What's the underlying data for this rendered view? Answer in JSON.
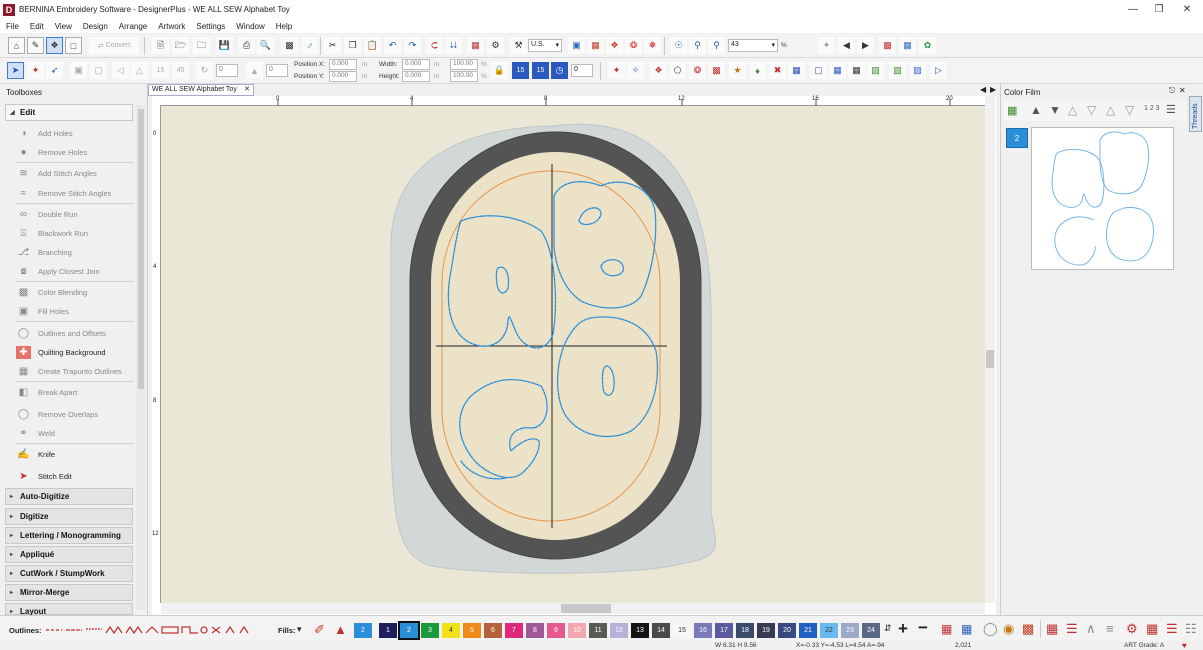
{
  "window": {
    "app_letter": "D",
    "title": "BERNINA Embroidery Software - DesignerPlus - WE ALL SEW Alphabet Toy"
  },
  "menu": [
    "File",
    "Edit",
    "View",
    "Design",
    "Arrange",
    "Artwork",
    "Settings",
    "Window",
    "Help"
  ],
  "toolbar1": {
    "convert_label": "Convert",
    "units_value": "U.S.",
    "zoom_value": "43",
    "zoom_unit": "%"
  },
  "toolbar2": {
    "rotate1": "15",
    "rotate2": "45",
    "angle_value": "0",
    "slant_value": "0",
    "position_x_label": "Position X:",
    "position_y_label": "Position Y:",
    "position_x_value": "0.000",
    "position_y_value": "0.000",
    "unit_in": "in",
    "width_label": "Width:",
    "height_label": "Height:",
    "width_value": "0.000",
    "height_value": "0.000",
    "width_pct": "100.00",
    "height_pct": "100.00",
    "pct": "%",
    "count1": "15",
    "count2": "15",
    "count_value": "0"
  },
  "left_panel": {
    "title": "Toolboxes",
    "edit_section": "Edit",
    "tools": [
      {
        "label": "Add Holes",
        "icon": "add-holes-icon"
      },
      {
        "label": "Remove Holes",
        "icon": "remove-holes-icon"
      },
      {
        "label": "Add Stitch Angles",
        "icon": "add-stitch-angles-icon"
      },
      {
        "label": "Remove Stitch Angles",
        "icon": "remove-stitch-angles-icon"
      },
      {
        "label": "Double Run",
        "icon": "double-run-icon"
      },
      {
        "label": "Blackwork Run",
        "icon": "blackwork-run-icon"
      },
      {
        "label": "Branching",
        "icon": "branching-icon"
      },
      {
        "label": "Apply Closest Join",
        "icon": "apply-closest-join-icon"
      },
      {
        "label": "Color Blending",
        "icon": "color-blending-icon"
      },
      {
        "label": "Fill Holes",
        "icon": "fill-holes-icon"
      },
      {
        "label": "Outlines and Offsets",
        "icon": "outlines-offsets-icon"
      },
      {
        "label": "Quilting Background",
        "icon": "quilting-background-icon"
      },
      {
        "label": "Create Trapunto Outlines",
        "icon": "trapunto-outlines-icon"
      },
      {
        "label": "Break Apart",
        "icon": "break-apart-icon"
      },
      {
        "label": "Remove Overlaps",
        "icon": "remove-overlaps-icon"
      },
      {
        "label": "Weld",
        "icon": "weld-icon"
      },
      {
        "label": "Knife",
        "icon": "knife-icon"
      },
      {
        "label": "Stitch Edit",
        "icon": "stitch-edit-icon"
      }
    ],
    "collapsed_sections": [
      "Auto-Digitize",
      "Digitize",
      "Lettering / Monogramming",
      "Appliqué",
      "CutWork / StumpWork",
      "Mirror-Merge",
      "Layout"
    ]
  },
  "document": {
    "tab_title": "WE ALL SEW Alphabet Toy",
    "ruler_top": [
      "0",
      "4",
      "8",
      "12",
      "16",
      "20"
    ],
    "ruler_left": [
      "0",
      "4",
      "8",
      "12"
    ]
  },
  "color_film": {
    "title": "Color Film",
    "threads_tab": "Threads",
    "block_number": "2",
    "sequence_label": "1 2 3"
  },
  "bottom": {
    "outlines_label": "Outlines:",
    "fills_label": "Fills:",
    "swatches": [
      {
        "n": "2",
        "c": "#2a8fd8"
      },
      {
        "n": "1",
        "c": "#1f1f5e"
      },
      {
        "n": "2",
        "c": "#2a8fd8"
      },
      {
        "n": "3",
        "c": "#1b9a3a"
      },
      {
        "n": "4",
        "c": "#f2e21a"
      },
      {
        "n": "5",
        "c": "#f08a18"
      },
      {
        "n": "6",
        "c": "#b5623a"
      },
      {
        "n": "7",
        "c": "#e0287a"
      },
      {
        "n": "8",
        "c": "#a05a9a"
      },
      {
        "n": "9",
        "c": "#e55a8a"
      },
      {
        "n": "10",
        "c": "#f4a7b0"
      },
      {
        "n": "11",
        "c": "#5a5a55"
      },
      {
        "n": "12",
        "c": "#b7b2d8"
      },
      {
        "n": "13",
        "c": "#151515"
      },
      {
        "n": "14",
        "c": "#4a4a4a"
      },
      {
        "n": "15",
        "c": "#f7f7f7"
      },
      {
        "n": "16",
        "c": "#7a7ab8"
      },
      {
        "n": "17",
        "c": "#5a5aa0"
      },
      {
        "n": "18",
        "c": "#3a4a6a"
      },
      {
        "n": "19",
        "c": "#3a3a55"
      },
      {
        "n": "20",
        "c": "#3a4a80"
      },
      {
        "n": "21",
        "c": "#2060c0"
      },
      {
        "n": "22",
        "c": "#6ab8f0"
      },
      {
        "n": "23",
        "c": "#9aaac8"
      },
      {
        "n": "24",
        "c": "#5a6a85"
      }
    ],
    "status": {
      "size": "W 6.31 H 9.56",
      "coords": "X=-0.33 Y=-4.53 L=4.54 A=-94",
      "stitches": "2,021",
      "art_grade": "ART Grade: A"
    }
  },
  "colors": {
    "accent": "#0a78d7",
    "stitch": "#2a8fd8",
    "hoop": "#545454",
    "outline": "#e8964a",
    "background": "#ebe7d6"
  }
}
